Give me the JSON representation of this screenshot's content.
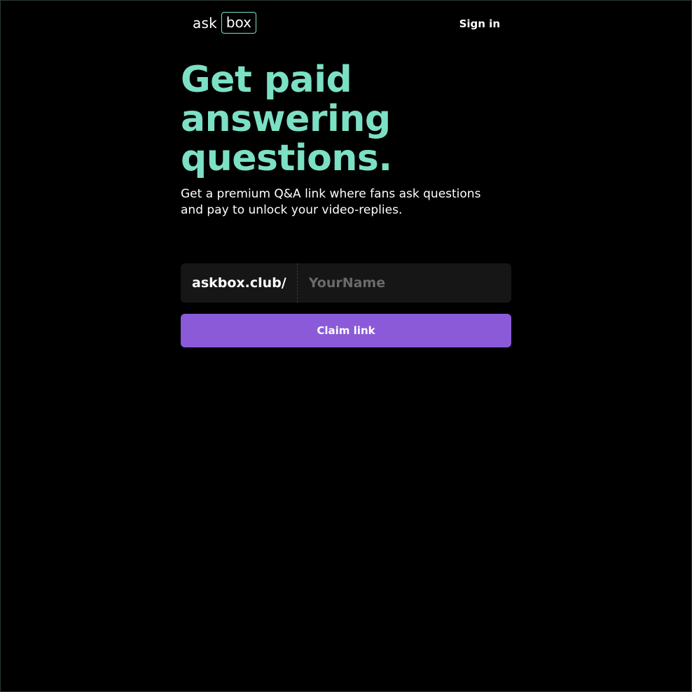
{
  "header": {
    "logo": {
      "ask": "ask",
      "box": "box"
    },
    "signin_label": "Sign in"
  },
  "hero": {
    "headline_line1": "Get paid",
    "headline_line2": "answering",
    "headline_line3": "questions.",
    "subtitle": "Get a premium Q&A link where fans ask questions and pay to unlock your video-replies."
  },
  "claim": {
    "prefix": "askbox.club/",
    "placeholder": "YourName",
    "value": "",
    "button_label": "Claim link"
  },
  "colors": {
    "background": "#000000",
    "accent_mint": "#7ce0c5",
    "button_purple": "#8b5ad9",
    "input_bg": "#161616"
  }
}
